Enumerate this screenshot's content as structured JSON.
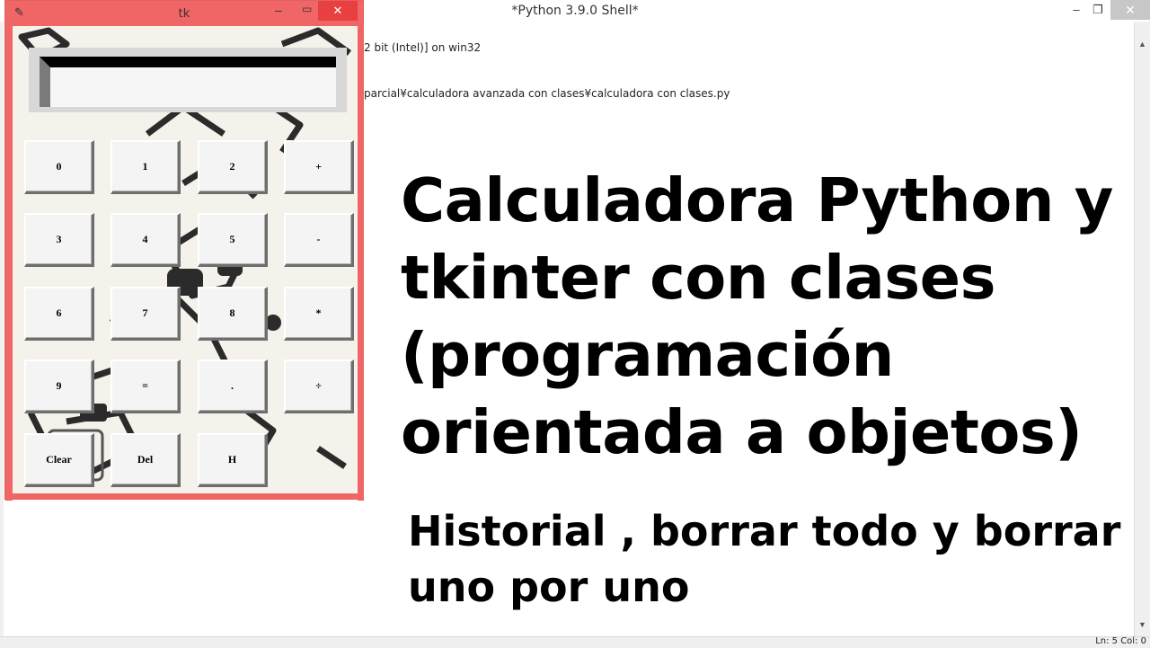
{
  "shell": {
    "title": "*Python 3.9.0 Shell*",
    "min_glyph": "–",
    "restore_glyph": "❐",
    "close_glyph": "✕",
    "lines": [
      "2 bit (Intel)] on win32",
      "parcial¥calculadora avanzada con clases¥calculadora con clases.py"
    ],
    "status": "Ln: 5   Col: 0"
  },
  "tk": {
    "title": "tk",
    "feather_glyph": "✎",
    "min_glyph": "–",
    "max_glyph": "▭",
    "close_glyph": "✕",
    "display_value": "",
    "buttons": [
      [
        "0",
        "1",
        "2",
        "+"
      ],
      [
        "3",
        "4",
        "5",
        "-"
      ],
      [
        "6",
        "7",
        "8",
        "*"
      ],
      [
        "9",
        "=",
        ".",
        "÷"
      ],
      [
        "Clear",
        "Del",
        "H"
      ]
    ]
  },
  "overlay": {
    "headline": [
      "Calculadora Python y",
      "tkinter con clases",
      "(programación",
      "orientada a objetos)"
    ],
    "subline": [
      "Historial , borrar todo y borrar",
      "uno por uno"
    ]
  },
  "colors": {
    "tk_frame": "#f06565",
    "tk_close": "#e84040",
    "headline_text": "#000000"
  }
}
